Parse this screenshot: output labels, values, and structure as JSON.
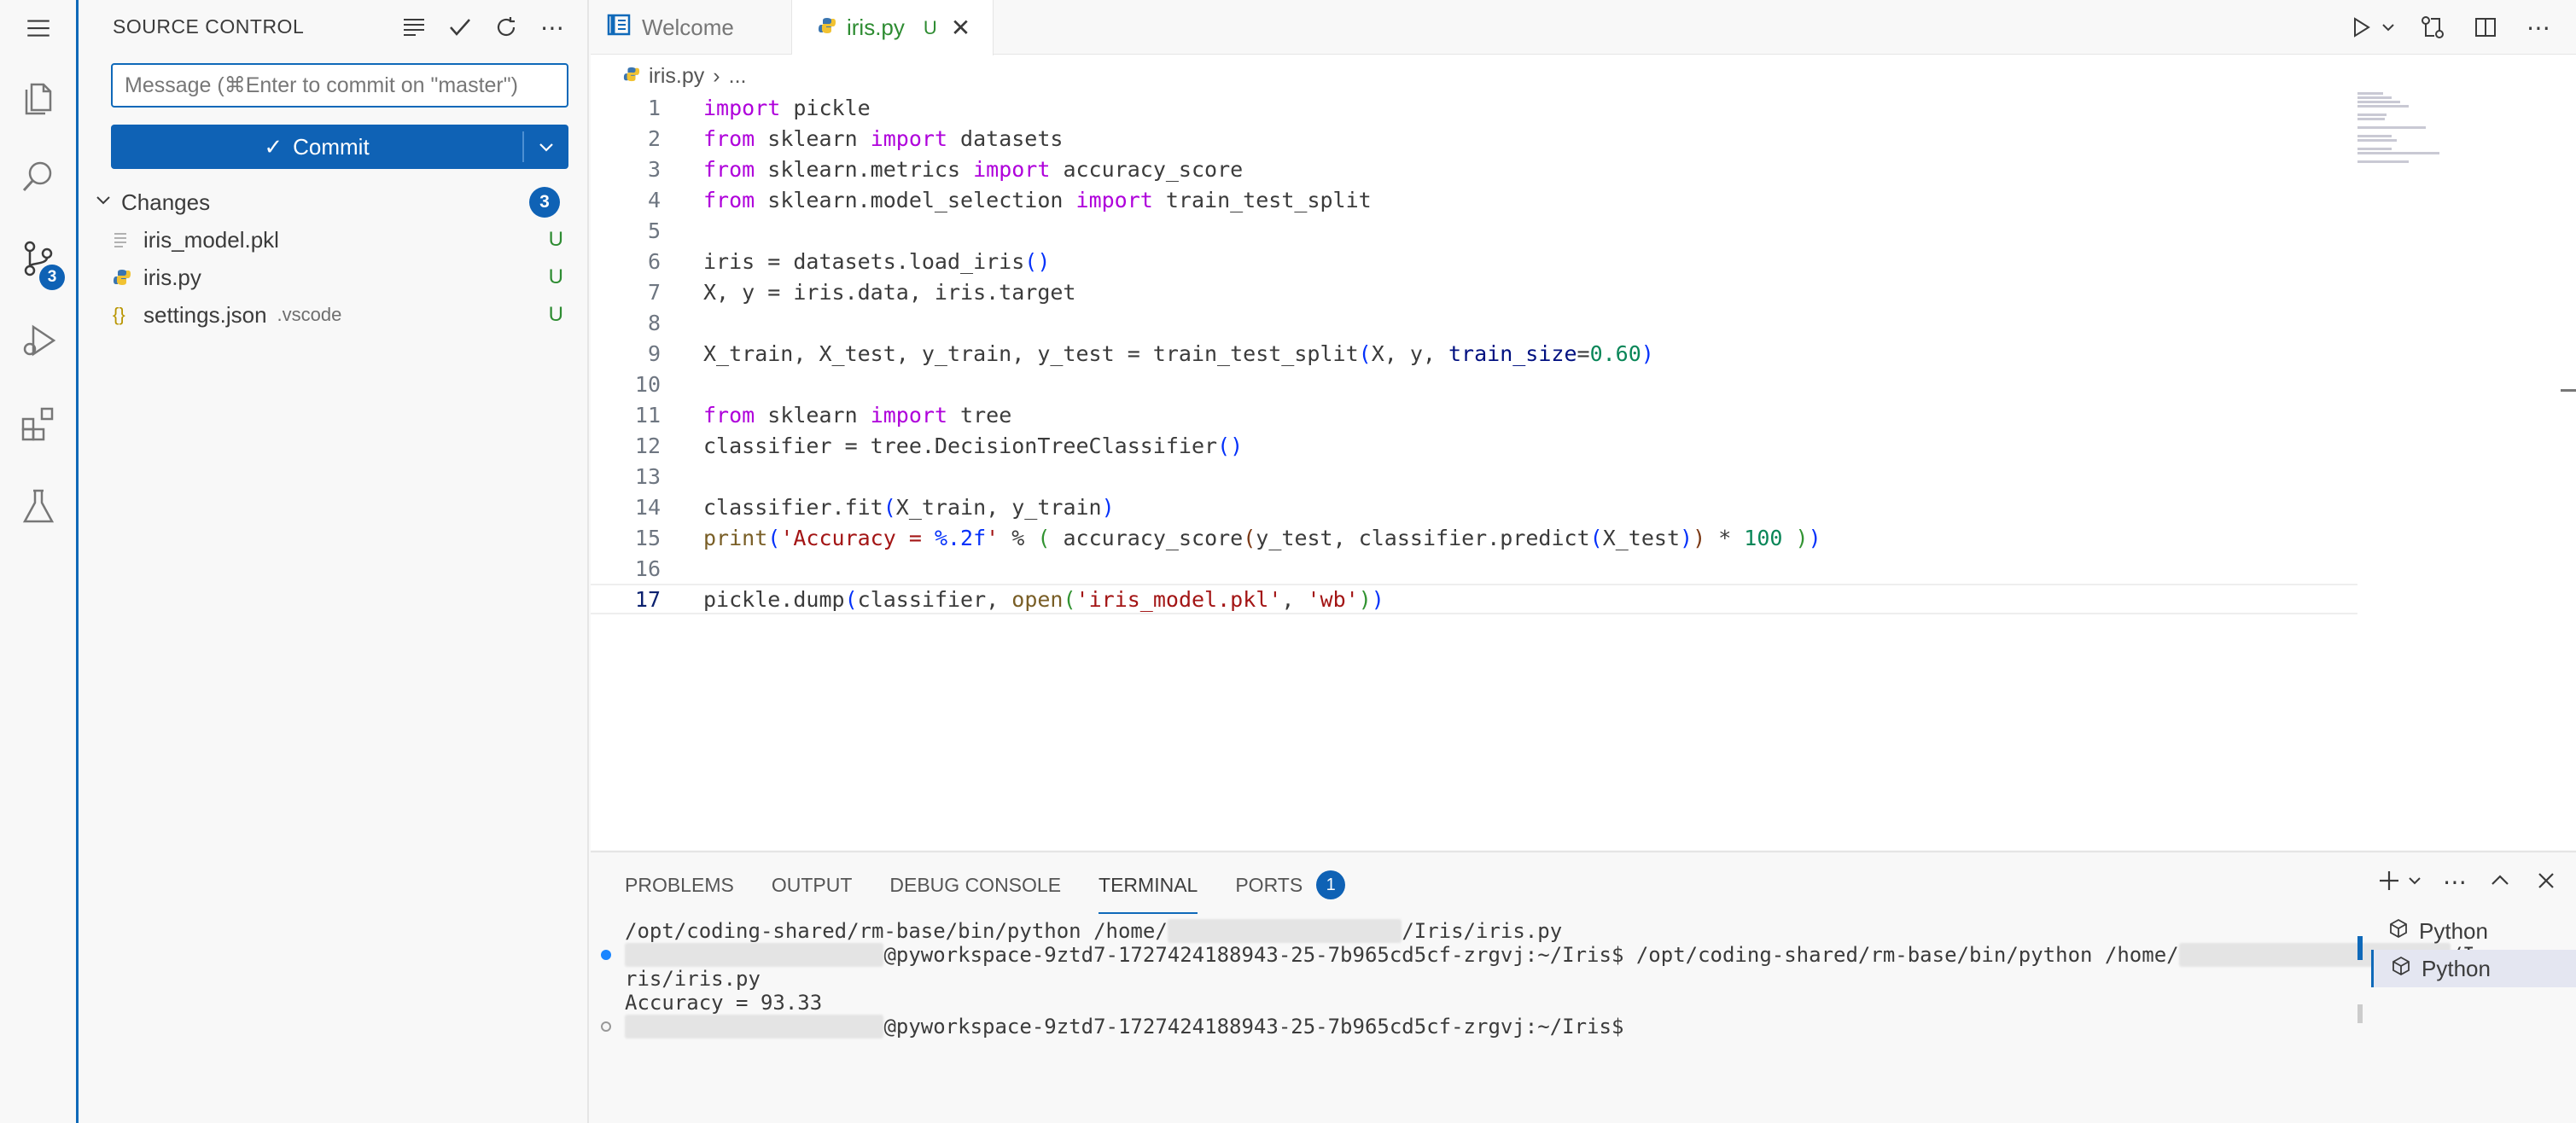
{
  "sidebar": {
    "title": "SOURCE CONTROL",
    "message_placeholder": "Message (⌘Enter to commit on \"master\")",
    "commit_label": "Commit",
    "changes_label": "Changes",
    "changes_count": "3",
    "files": [
      {
        "name": "iris_model.pkl",
        "dir": "",
        "status": "U",
        "icon": "file-lines-icon"
      },
      {
        "name": "iris.py",
        "dir": "",
        "status": "U",
        "icon": "python-icon"
      },
      {
        "name": "settings.json",
        "dir": ".vscode",
        "status": "U",
        "icon": "json-braces-icon"
      }
    ]
  },
  "activity": {
    "scm_badge": "3"
  },
  "tabs": [
    {
      "label": "Welcome"
    },
    {
      "label": "iris.py",
      "modified": "U"
    }
  ],
  "breadcrumb": {
    "file": "iris.py",
    "more": "..."
  },
  "code": {
    "line_numbers": [
      "1",
      "2",
      "3",
      "4",
      "5",
      "6",
      "7",
      "8",
      "9",
      "10",
      "11",
      "12",
      "13",
      "14",
      "15",
      "16",
      "17"
    ],
    "current_line": "17"
  },
  "panel": {
    "tabs": [
      "PROBLEMS",
      "OUTPUT",
      "DEBUG CONSOLE",
      "TERMINAL",
      "PORTS"
    ],
    "ports_badge": "1",
    "terminal_lines": {
      "l1a": "/opt/coding-shared/rm-base/bin/python /home/",
      "l1b": "/Iris/iris.py",
      "l2a": "@pyworkspace-9ztd7-1727424188943-25-7b965cd5cf-zrgvj:~/Iris$ /opt/coding-shared/rm-base/bin/python /home/",
      "l2b": "/I",
      "l3": "ris/iris.py",
      "l4": "Accuracy = 93.33",
      "l5a": "@pyworkspace-9ztd7-1727424188943-25-7b965cd5cf-zrgvj:~/Iris$"
    },
    "terminals": [
      "Python",
      "Python"
    ]
  },
  "colors": {
    "accent": "#0f62b5",
    "untracked": "#2e8c32"
  }
}
